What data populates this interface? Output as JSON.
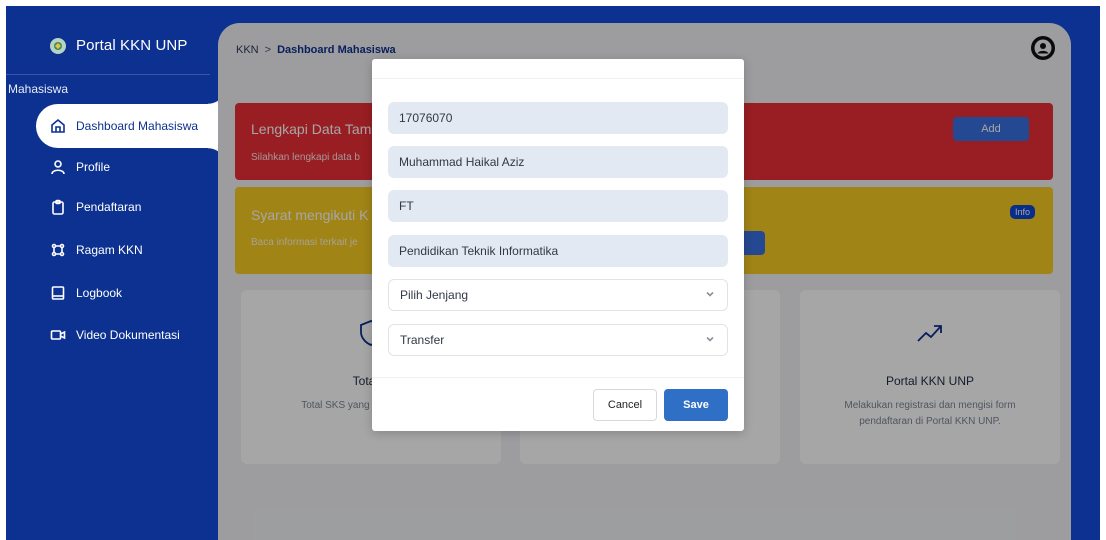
{
  "app": {
    "title": "Portal KKN UNP",
    "section_label": "Mahasiswa"
  },
  "sidebar": {
    "items": [
      {
        "label": "Dashboard Mahasiswa",
        "icon": "home-icon",
        "active": true
      },
      {
        "label": "Profile",
        "icon": "user-icon"
      },
      {
        "label": "Pendaftaran",
        "icon": "clipboard-icon"
      },
      {
        "label": "Ragam KKN",
        "icon": "grid-icon"
      },
      {
        "label": "Logbook",
        "icon": "book-icon"
      },
      {
        "label": "Video Dokumentasi",
        "icon": "video-icon"
      }
    ]
  },
  "breadcrumb": {
    "root": "KKN",
    "separator": ">",
    "current": "Dashboard Mahasiswa"
  },
  "banners": {
    "red": {
      "title": "Lengkapi Data Tam",
      "subtitle": "Silahkan lengkapi data b",
      "button": "Add"
    },
    "yellow": {
      "title": "Syarat mengikuti K",
      "subtitle": "Baca informasi terkait je",
      "badge": "Info"
    }
  },
  "cards": [
    {
      "title": "Total S",
      "desc": "Total SKS yang diselesaikan mi",
      "icon": "shield-icon"
    },
    {
      "title": "",
      "desc": "",
      "icon": ""
    },
    {
      "title": "Portal KKN UNP",
      "desc": "Melakukan registrasi dan mengisi form pendaftaran di Portal KKN UNP.",
      "icon": "trending-up-icon"
    }
  ],
  "modal": {
    "nim": "17076070",
    "name": "Muhammad Haikal Aziz",
    "faculty": "FT",
    "program": "Pendidikan Teknik Informatika",
    "jenjang": "Pilih Jenjang",
    "type": "Transfer",
    "cancel": "Cancel",
    "save": "Save"
  },
  "colors": {
    "brand": "#0d3190",
    "red_banner": "#ea2f36",
    "yellow_banner": "#f7cb22",
    "primary_button": "#2f70c6"
  }
}
